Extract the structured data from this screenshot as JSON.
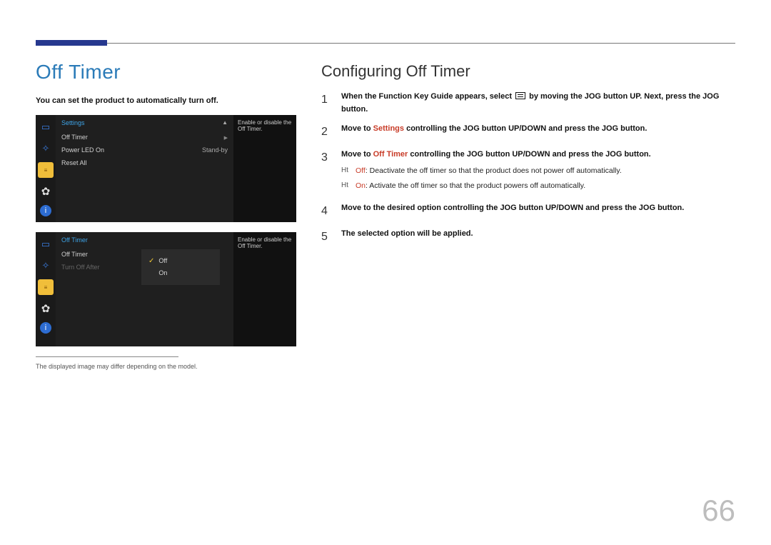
{
  "page_number": "66",
  "left": {
    "title": "Off Timer",
    "intro": "You can set the product to automatically turn off.",
    "footnote": "The displayed image may differ depending on the model.",
    "osd1": {
      "head": "Settings",
      "rows": [
        {
          "label": "Off Timer",
          "val": "",
          "has_arrow": true
        },
        {
          "label": "Power LED On",
          "val": "Stand-by"
        },
        {
          "label": "Reset All",
          "val": ""
        }
      ],
      "help": "Enable or disable the Off Timer."
    },
    "osd2": {
      "head": "Off Timer",
      "rows": [
        {
          "label": "Off Timer",
          "val": ""
        },
        {
          "label": "Turn Off After",
          "val": "",
          "dim": true
        }
      ],
      "popup": {
        "options": [
          {
            "label": "Off",
            "checked": true
          },
          {
            "label": "On",
            "checked": false
          }
        ]
      },
      "help": "Enable or disable the Off Timer."
    }
  },
  "right": {
    "title": "Configuring Off Timer",
    "steps": {
      "s1": "When the Function Key Guide appears, select",
      "s1b": "by moving the JOG button UP. Next, press the JOG button.",
      "s2a": "Move to ",
      "s2_link": "Settings",
      "s2b": " controlling the JOG button UP/DOWN and press the JOG button.",
      "s3a": "Move to ",
      "s3_link": "Off Timer",
      "s3b": " controlling the JOG button UP/DOWN and press the JOG button.",
      "s3_sub_off_label": "Off",
      "s3_sub_off": ": Deactivate the off timer so that the product does not power off automatically.",
      "s3_sub_on_label": "On",
      "s3_sub_on": ": Activate the off timer so that the product powers off automatically.",
      "s4": "Move to the desired option controlling the JOG button UP/DOWN and press the JOG button.",
      "s5": "The selected option will be applied."
    }
  }
}
